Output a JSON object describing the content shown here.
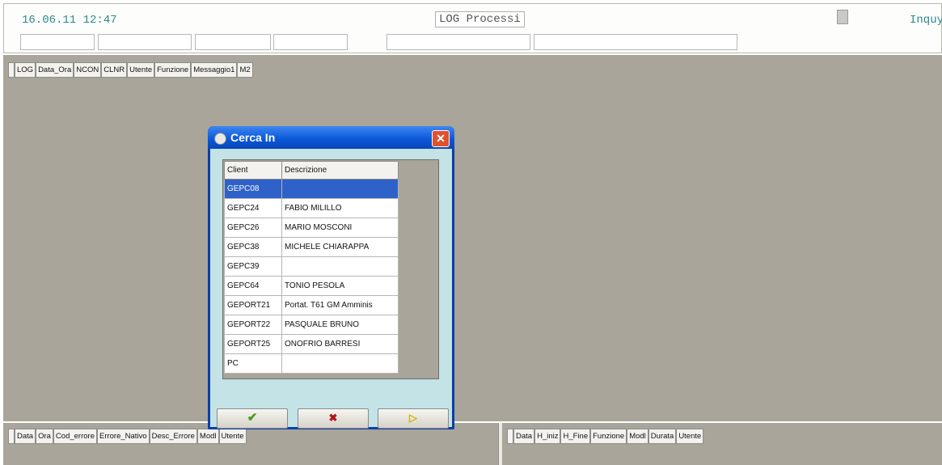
{
  "top": {
    "datetime": "16.06.11 12:47",
    "title": "LOG Processi",
    "inquiry": "Inquy"
  },
  "main_grid": {
    "columns": [
      "LOG",
      "Data_Ora",
      "NCON",
      "CLNR",
      "Utente",
      "Funzione",
      "Messaggio1",
      "M2"
    ]
  },
  "errors_grid": {
    "columns": [
      "Data",
      "Ora",
      "Cod_errore",
      "Errore_Nativo",
      "Desc_Errore",
      "Modl",
      "Utente"
    ]
  },
  "sessions_grid": {
    "columns": [
      "Data",
      "H_iniz",
      "H_Fine",
      "Funzione",
      "Modl",
      "Durata",
      "Utente"
    ]
  },
  "dialog": {
    "title": "Cerca In",
    "close": "✕",
    "col_client": "Client",
    "col_desc": "Descrizione",
    "rows": [
      {
        "client": "GEPC08",
        "desc": ""
      },
      {
        "client": "GEPC24",
        "desc": "FABIO MILILLO"
      },
      {
        "client": "GEPC26",
        "desc": "MARIO MOSCONI"
      },
      {
        "client": "GEPC38",
        "desc": "MICHELE CHIARAPPA"
      },
      {
        "client": "GEPC39",
        "desc": ""
      },
      {
        "client": "GEPC64",
        "desc": "TONIO PESOLA"
      },
      {
        "client": "GEPORT21",
        "desc": "Portat. T61 GM Amminis"
      },
      {
        "client": "GEPORT22",
        "desc": "PASQUALE BRUNO"
      },
      {
        "client": "GEPORT25",
        "desc": "ONOFRIO BARRESI"
      },
      {
        "client": "PC",
        "desc": ""
      }
    ],
    "btn_ok": "✔",
    "btn_cancel": "✖",
    "btn_next": "▷",
    "colors": {
      "ok": "#4a9a1a",
      "cancel": "#b01818",
      "next": "#d9b000",
      "selected_row": "#2e62c9"
    }
  }
}
